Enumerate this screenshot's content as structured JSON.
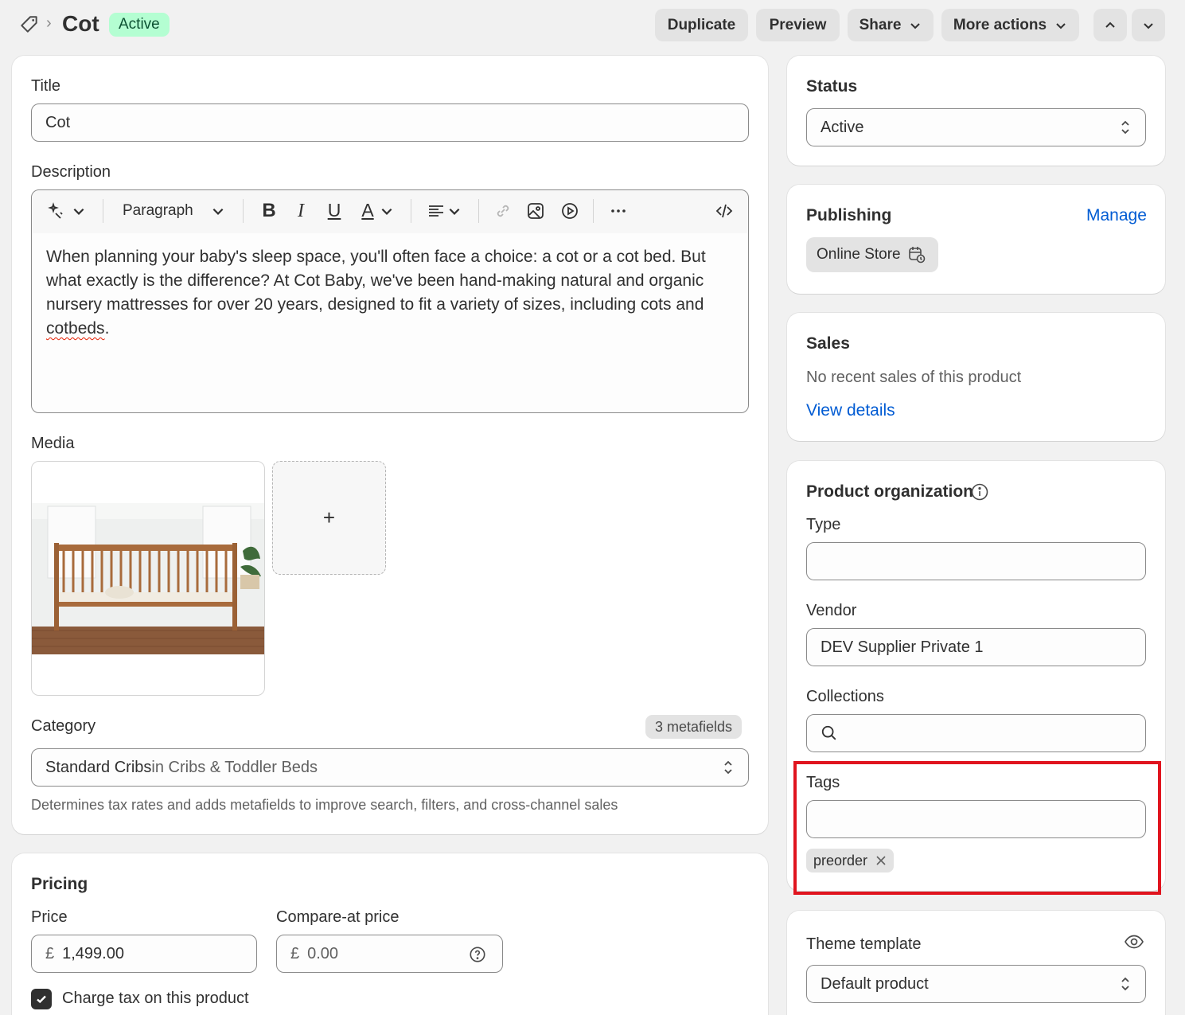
{
  "header": {
    "title": "Cot",
    "status_badge": "Active",
    "buttons": {
      "duplicate": "Duplicate",
      "preview": "Preview",
      "share": "Share",
      "more_actions": "More actions"
    }
  },
  "main": {
    "title_label": "Title",
    "title_value": "Cot",
    "description_label": "Description",
    "toolbar": {
      "paragraph": "Paragraph"
    },
    "description_text_1": "When planning your baby's sleep space, you'll often face a choice: a cot or a cot bed. But what exactly is the difference? At Cot Baby, we've been hand-making natural and organic nursery mattresses for over 20 years, designed to fit a variety of sizes, including cots and ",
    "description_misspelled": "cotbeds",
    "description_text_2": ".",
    "media_label": "Media",
    "add_media_symbol": "+",
    "category_label": "Category",
    "metafields_badge": "3 metafields",
    "category_value": "Standard Cribs",
    "category_parent": " in Cribs & Toddler Beds",
    "category_help": "Determines tax rates and adds metafields to improve search, filters, and cross-channel sales"
  },
  "pricing": {
    "heading": "Pricing",
    "price_label": "Price",
    "currency": "£",
    "price_value": "1,499.00",
    "compare_label": "Compare-at price",
    "compare_placeholder": "0.00",
    "charge_tax_label": "Charge tax on this product",
    "charge_tax_checked": true
  },
  "sidebar": {
    "status": {
      "heading": "Status",
      "value": "Active"
    },
    "publishing": {
      "heading": "Publishing",
      "manage": "Manage",
      "channel": "Online Store"
    },
    "sales": {
      "heading": "Sales",
      "text": "No recent sales of this product",
      "link": "View details"
    },
    "organization": {
      "heading": "Product organization",
      "type_label": "Type",
      "type_value": "",
      "vendor_label": "Vendor",
      "vendor_value": "DEV Supplier Private 1",
      "collections_label": "Collections",
      "tags_label": "Tags",
      "tags": [
        "preorder"
      ]
    },
    "theme": {
      "heading": "Theme template",
      "value": "Default product"
    }
  },
  "colors": {
    "highlight_box": "#e0141e",
    "link": "#005bd3",
    "badge_bg": "#b4fed2"
  }
}
